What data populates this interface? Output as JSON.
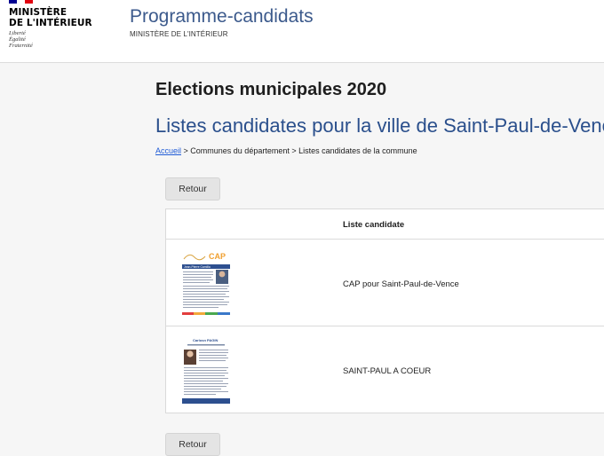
{
  "header": {
    "logo_title_line1": "MINISTÈRE",
    "logo_title_line2": "DE L'INTÉRIEUR",
    "logo_motto_1": "Liberté",
    "logo_motto_2": "Égalité",
    "logo_motto_3": "Fraternité",
    "site_title": "Programme-candidats",
    "site_subtitle": "MINISTÈRE DE L'INTÉRIEUR"
  },
  "main": {
    "page_heading": "Elections municipales 2020",
    "city_heading": "Listes candidates pour la ville de Saint-Paul-de-Vence",
    "breadcrumb": {
      "home": "Accueil",
      "sep1": " > ",
      "level2": "Communes du département",
      "sep2": " > ",
      "current": "Listes candidates de la commune"
    },
    "back_button_top": "Retour",
    "back_button_bottom": "Retour",
    "table": {
      "column_header": "Liste candidate",
      "rows": [
        {
          "name": "CAP pour Saint-Paul-de-Vence",
          "thumb_logo": "CAP",
          "thumb_banner": "Jean-Pierre Camilla"
        },
        {
          "name": "SAINT-PAUL A COEUR",
          "thumb_logo": "Carlosn PAGIN",
          "thumb_banner": ""
        }
      ]
    }
  },
  "colors": {
    "link_blue": "#1f5bd6",
    "title_blue": "#3c5a8c",
    "city_blue": "#2a4f8c",
    "flag_blue": "#000091",
    "flag_red": "#e1000f"
  }
}
